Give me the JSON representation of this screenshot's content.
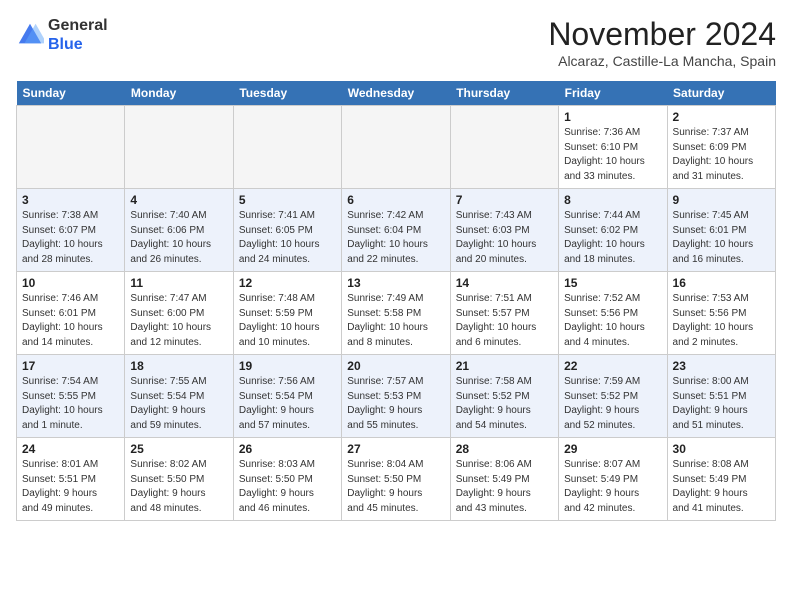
{
  "header": {
    "logo_line1": "General",
    "logo_line2": "Blue",
    "month_year": "November 2024",
    "location": "Alcaraz, Castille-La Mancha, Spain"
  },
  "days_of_week": [
    "Sunday",
    "Monday",
    "Tuesday",
    "Wednesday",
    "Thursday",
    "Friday",
    "Saturday"
  ],
  "weeks": [
    [
      {
        "day": "",
        "info": ""
      },
      {
        "day": "",
        "info": ""
      },
      {
        "day": "",
        "info": ""
      },
      {
        "day": "",
        "info": ""
      },
      {
        "day": "",
        "info": ""
      },
      {
        "day": "1",
        "info": "Sunrise: 7:36 AM\nSunset: 6:10 PM\nDaylight: 10 hours\nand 33 minutes."
      },
      {
        "day": "2",
        "info": "Sunrise: 7:37 AM\nSunset: 6:09 PM\nDaylight: 10 hours\nand 31 minutes."
      }
    ],
    [
      {
        "day": "3",
        "info": "Sunrise: 7:38 AM\nSunset: 6:07 PM\nDaylight: 10 hours\nand 28 minutes."
      },
      {
        "day": "4",
        "info": "Sunrise: 7:40 AM\nSunset: 6:06 PM\nDaylight: 10 hours\nand 26 minutes."
      },
      {
        "day": "5",
        "info": "Sunrise: 7:41 AM\nSunset: 6:05 PM\nDaylight: 10 hours\nand 24 minutes."
      },
      {
        "day": "6",
        "info": "Sunrise: 7:42 AM\nSunset: 6:04 PM\nDaylight: 10 hours\nand 22 minutes."
      },
      {
        "day": "7",
        "info": "Sunrise: 7:43 AM\nSunset: 6:03 PM\nDaylight: 10 hours\nand 20 minutes."
      },
      {
        "day": "8",
        "info": "Sunrise: 7:44 AM\nSunset: 6:02 PM\nDaylight: 10 hours\nand 18 minutes."
      },
      {
        "day": "9",
        "info": "Sunrise: 7:45 AM\nSunset: 6:01 PM\nDaylight: 10 hours\nand 16 minutes."
      }
    ],
    [
      {
        "day": "10",
        "info": "Sunrise: 7:46 AM\nSunset: 6:01 PM\nDaylight: 10 hours\nand 14 minutes."
      },
      {
        "day": "11",
        "info": "Sunrise: 7:47 AM\nSunset: 6:00 PM\nDaylight: 10 hours\nand 12 minutes."
      },
      {
        "day": "12",
        "info": "Sunrise: 7:48 AM\nSunset: 5:59 PM\nDaylight: 10 hours\nand 10 minutes."
      },
      {
        "day": "13",
        "info": "Sunrise: 7:49 AM\nSunset: 5:58 PM\nDaylight: 10 hours\nand 8 minutes."
      },
      {
        "day": "14",
        "info": "Sunrise: 7:51 AM\nSunset: 5:57 PM\nDaylight: 10 hours\nand 6 minutes."
      },
      {
        "day": "15",
        "info": "Sunrise: 7:52 AM\nSunset: 5:56 PM\nDaylight: 10 hours\nand 4 minutes."
      },
      {
        "day": "16",
        "info": "Sunrise: 7:53 AM\nSunset: 5:56 PM\nDaylight: 10 hours\nand 2 minutes."
      }
    ],
    [
      {
        "day": "17",
        "info": "Sunrise: 7:54 AM\nSunset: 5:55 PM\nDaylight: 10 hours\nand 1 minute."
      },
      {
        "day": "18",
        "info": "Sunrise: 7:55 AM\nSunset: 5:54 PM\nDaylight: 9 hours\nand 59 minutes."
      },
      {
        "day": "19",
        "info": "Sunrise: 7:56 AM\nSunset: 5:54 PM\nDaylight: 9 hours\nand 57 minutes."
      },
      {
        "day": "20",
        "info": "Sunrise: 7:57 AM\nSunset: 5:53 PM\nDaylight: 9 hours\nand 55 minutes."
      },
      {
        "day": "21",
        "info": "Sunrise: 7:58 AM\nSunset: 5:52 PM\nDaylight: 9 hours\nand 54 minutes."
      },
      {
        "day": "22",
        "info": "Sunrise: 7:59 AM\nSunset: 5:52 PM\nDaylight: 9 hours\nand 52 minutes."
      },
      {
        "day": "23",
        "info": "Sunrise: 8:00 AM\nSunset: 5:51 PM\nDaylight: 9 hours\nand 51 minutes."
      }
    ],
    [
      {
        "day": "24",
        "info": "Sunrise: 8:01 AM\nSunset: 5:51 PM\nDaylight: 9 hours\nand 49 minutes."
      },
      {
        "day": "25",
        "info": "Sunrise: 8:02 AM\nSunset: 5:50 PM\nDaylight: 9 hours\nand 48 minutes."
      },
      {
        "day": "26",
        "info": "Sunrise: 8:03 AM\nSunset: 5:50 PM\nDaylight: 9 hours\nand 46 minutes."
      },
      {
        "day": "27",
        "info": "Sunrise: 8:04 AM\nSunset: 5:50 PM\nDaylight: 9 hours\nand 45 minutes."
      },
      {
        "day": "28",
        "info": "Sunrise: 8:06 AM\nSunset: 5:49 PM\nDaylight: 9 hours\nand 43 minutes."
      },
      {
        "day": "29",
        "info": "Sunrise: 8:07 AM\nSunset: 5:49 PM\nDaylight: 9 hours\nand 42 minutes."
      },
      {
        "day": "30",
        "info": "Sunrise: 8:08 AM\nSunset: 5:49 PM\nDaylight: 9 hours\nand 41 minutes."
      }
    ]
  ]
}
